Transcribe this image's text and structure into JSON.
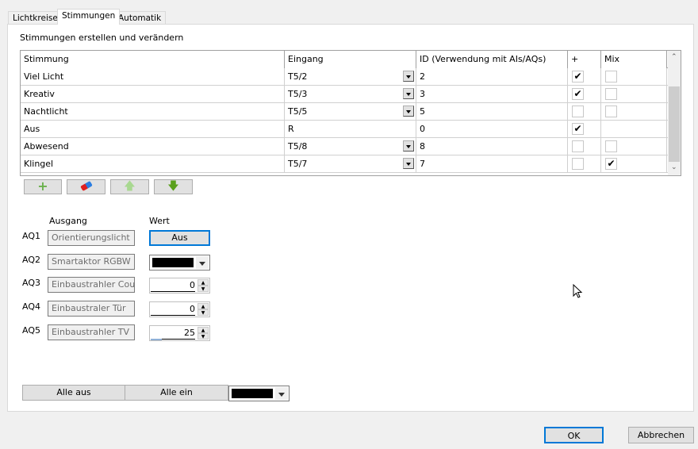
{
  "tabs": [
    {
      "label": "Lichtkreise"
    },
    {
      "label": "Stimmungen",
      "active": true
    },
    {
      "label": "Automatik"
    }
  ],
  "section_title": "Stimmungen erstellen und verändern",
  "table": {
    "headers": [
      "Stimmung",
      "Eingang",
      "ID (Verwendung mit AIs/AQs)",
      "+",
      "Mix"
    ],
    "rows": [
      {
        "name": "Viel Licht",
        "input": "T5/2",
        "id": "2",
        "plus": true,
        "mix": false,
        "has_dropdown": true,
        "has_mix": true
      },
      {
        "name": "Kreativ",
        "input": "T5/3",
        "id": "3",
        "plus": true,
        "mix": false,
        "has_dropdown": true,
        "has_mix": true
      },
      {
        "name": "Nachtlicht",
        "input": "T5/5",
        "id": "5",
        "plus": false,
        "mix": false,
        "has_dropdown": true,
        "has_mix": true
      },
      {
        "name": "Aus",
        "input": "R",
        "id": "0",
        "plus": true,
        "mix": false,
        "has_dropdown": false,
        "has_mix": false
      },
      {
        "name": "Abwesend",
        "input": "T5/8",
        "id": "8",
        "plus": false,
        "mix": false,
        "has_dropdown": true,
        "has_mix": true
      },
      {
        "name": "Klingel",
        "input": "T5/7",
        "id": "7",
        "plus": false,
        "mix": true,
        "has_dropdown": true,
        "has_mix": true
      }
    ]
  },
  "toolbar_icons": [
    "plus-icon",
    "eraser-icon",
    "arrow-up-icon",
    "arrow-down-icon"
  ],
  "outputs": {
    "header_output": "Ausgang",
    "header_value": "Wert",
    "rows": [
      {
        "id": "AQ1",
        "name": "Orientierungslicht",
        "type": "button",
        "value": "Aus"
      },
      {
        "id": "AQ2",
        "name": "Smartaktor RGBW",
        "type": "color",
        "value": "#000000"
      },
      {
        "id": "AQ3",
        "name": "Einbaustrahler Couch",
        "type": "spin",
        "value": "0"
      },
      {
        "id": "AQ4",
        "name": "Einbaustraler Tür",
        "type": "spin",
        "value": "0"
      },
      {
        "id": "AQ5",
        "name": "Einbaustrahler TV",
        "type": "spin",
        "value": "25"
      }
    ]
  },
  "bottom": {
    "all_off": "Alle aus",
    "all_on": "Alle ein",
    "color": "#000000"
  },
  "dialog": {
    "ok": "OK",
    "cancel": "Abbrechen"
  }
}
